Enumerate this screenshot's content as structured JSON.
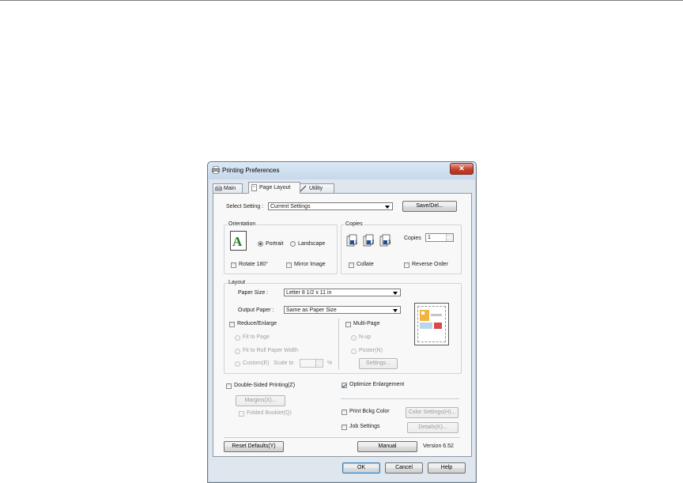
{
  "window": {
    "title": "Printing Preferences",
    "close_glyph": "✕"
  },
  "tabs": [
    {
      "label": "Main",
      "icon": "printer-icon"
    },
    {
      "label": "Page Layout",
      "icon": "page-layout-icon",
      "active": true
    },
    {
      "label": "Utility",
      "icon": "pencil-icon"
    }
  ],
  "select_setting": {
    "label": "Select Setting :",
    "value": "Current Settings",
    "save_button": "Save/Del..."
  },
  "orientation": {
    "group_label": "Orientation",
    "portrait": "Portrait",
    "landscape": "Landscape",
    "rotate": "Rotate 180°",
    "mirror": "Mirror Image",
    "selected": "Portrait"
  },
  "copies": {
    "group_label": "Copies",
    "copies_label": "Copies",
    "copies_value": "1",
    "collate": "Collate",
    "reverse": "Reverse Order"
  },
  "layout": {
    "group_label": "Layout",
    "paper_size_label": "Paper Size :",
    "paper_size_value": "Letter 8 1/2 x 11 in",
    "output_paper_label": "Output Paper :",
    "output_paper_value": "Same as Paper Size",
    "reduce_enlarge": "Reduce/Enlarge",
    "fit_to_page": "Fit to Page",
    "fit_roll": "Fit to Roll Paper Width",
    "custom": "Custom(E)",
    "scale_to": "Scale to",
    "percent": "%",
    "multi_page": "Multi-Page",
    "n_up": "N-up",
    "poster": "Poster(N)",
    "settings_button": "Settings..."
  },
  "double_sided": {
    "label": "Double-Sided Printing(Z)",
    "margins_button": "Margins(X)...",
    "folded_booklet": "Folded Booklet(Q)"
  },
  "optimize": {
    "label": "Optimize Enlargement",
    "checked": true
  },
  "print_bkg": {
    "label": "Print Bckg Color",
    "button": "Color Settings(H)..."
  },
  "job_settings": {
    "label": "Job Settings",
    "button": "Details(K)..."
  },
  "bottom": {
    "reset": "Reset Defaults(Y)",
    "manual": "Manual",
    "version": "Version 6.52"
  },
  "footer": {
    "ok": "OK",
    "cancel": "Cancel",
    "help": "Help"
  }
}
